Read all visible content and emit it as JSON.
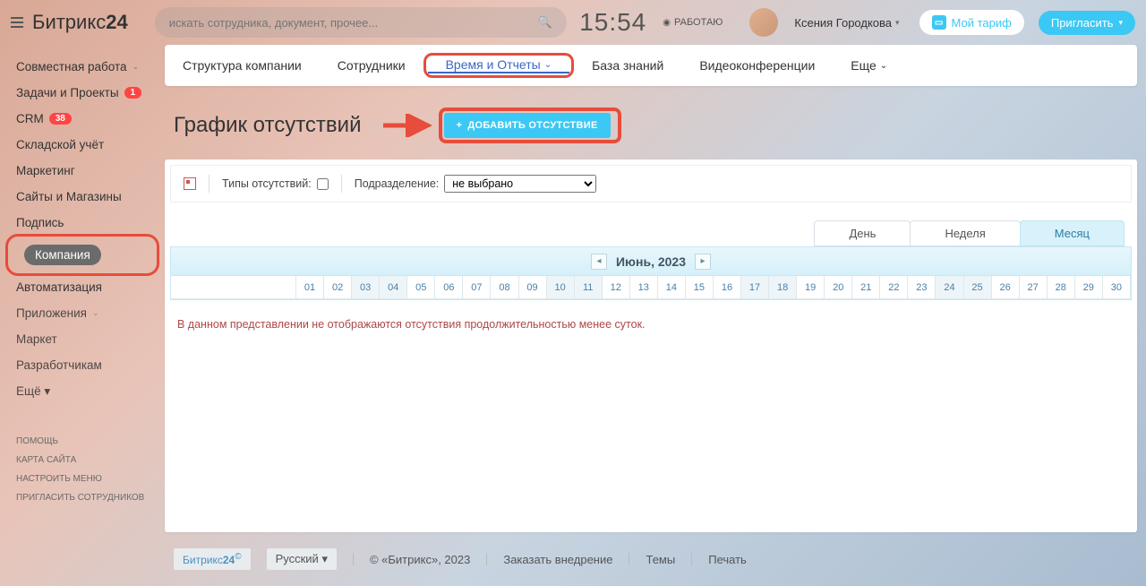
{
  "header": {
    "logo_a": "Битрикс",
    "logo_b": "24",
    "search_placeholder": "искать сотрудника, документ, прочее...",
    "clock": "15:54",
    "work_status": "РАБОТАЮ",
    "username": "Ксения Городкова",
    "tariff_label": "Мой тариф",
    "invite_label": "Пригласить"
  },
  "sidebar": {
    "items": [
      {
        "label": "Совместная работа",
        "chev": true
      },
      {
        "label": "Задачи и Проекты",
        "badge": "1"
      },
      {
        "label": "CRM",
        "badge": "38"
      },
      {
        "label": "Складской учёт"
      },
      {
        "label": "Маркетинг"
      },
      {
        "label": "Сайты и Магазины"
      },
      {
        "label": "Подпись"
      },
      {
        "label": "Компания",
        "active": true
      },
      {
        "label": "Автоматизация"
      },
      {
        "label": "Приложения",
        "chev": true,
        "sub": true
      },
      {
        "label": "Маркет",
        "sub": true
      },
      {
        "label": "Разработчикам",
        "sub": true
      },
      {
        "label": "Ещё ▾",
        "sub": true
      }
    ],
    "footer": [
      "ПОМОЩЬ",
      "КАРТА САЙТА",
      "НАСТРОИТЬ МЕНЮ",
      "ПРИГЛАСИТЬ СОТРУДНИКОВ"
    ]
  },
  "tabs": {
    "items": [
      "Структура компании",
      "Сотрудники",
      "Время и Отчеты",
      "База знаний",
      "Видеоконференции",
      "Еще"
    ],
    "active_index": 2
  },
  "page": {
    "title": "График отсутствий",
    "add_button": "ДОБАВИТЬ ОТСУТСТВИЕ",
    "filters": {
      "types_label": "Типы отсутствий:",
      "dept_label": "Подразделение:",
      "dept_value": "не выбрано"
    },
    "view_tabs": {
      "day": "День",
      "week": "Неделя",
      "month": "Месяц"
    },
    "month_label": "Июнь, 2023",
    "days": [
      "01",
      "02",
      "03",
      "04",
      "05",
      "06",
      "07",
      "08",
      "09",
      "10",
      "11",
      "12",
      "13",
      "14",
      "15",
      "16",
      "17",
      "18",
      "19",
      "20",
      "21",
      "22",
      "23",
      "24",
      "25",
      "26",
      "27",
      "28",
      "29",
      "30"
    ],
    "weekend_idx": [
      2,
      3,
      9,
      10,
      16,
      17,
      23,
      24
    ],
    "note": "В данном представлении не отображаются отсутствия продолжительностью менее суток."
  },
  "footer": {
    "brand_a": "Битрикс",
    "brand_b": "24",
    "lang": "Русский",
    "copyright": "© «Битрикс», 2023",
    "links": [
      "Заказать внедрение",
      "Темы",
      "Печать"
    ]
  }
}
